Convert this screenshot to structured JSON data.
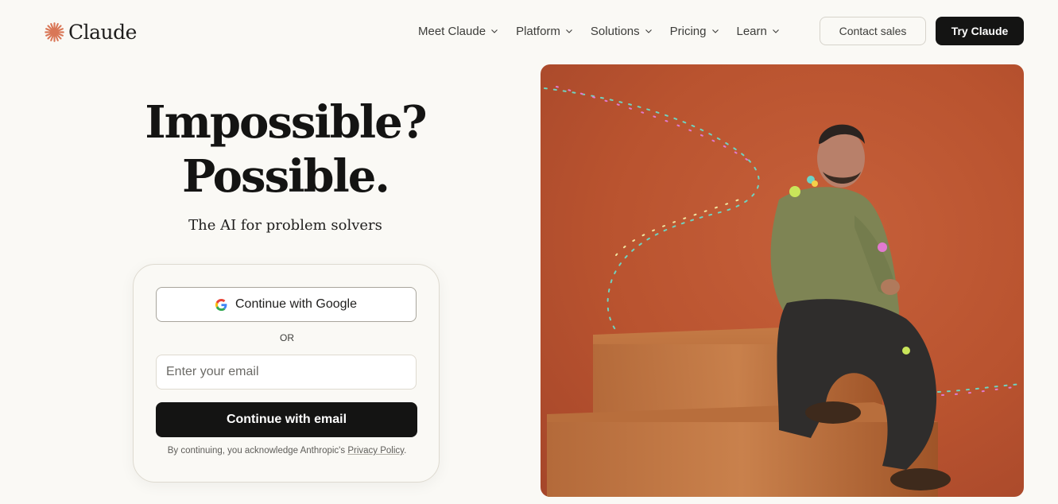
{
  "header": {
    "logo_text": "Claude",
    "logo_icon": "claude-starburst-icon",
    "nav": [
      {
        "label": "Meet Claude"
      },
      {
        "label": "Platform"
      },
      {
        "label": "Solutions"
      },
      {
        "label": "Pricing"
      },
      {
        "label": "Learn"
      }
    ],
    "contact_label": "Contact sales",
    "try_label": "Try Claude"
  },
  "hero": {
    "title_line1": "Impossible?",
    "title_line2": "Possible.",
    "subtitle": "The AI for problem solvers"
  },
  "signin": {
    "google_label": "Continue with Google",
    "or_label": "OR",
    "email_placeholder": "Enter your email",
    "email_button_label": "Continue with email",
    "legal_prefix": "By continuing, you acknowledge Anthropic's",
    "privacy_link": "Privacy Policy",
    "legal_suffix": "."
  },
  "colors": {
    "accent": "#d97757",
    "background": "#faf9f5",
    "primary_button": "#141413",
    "photo_background": "#b9532f"
  }
}
